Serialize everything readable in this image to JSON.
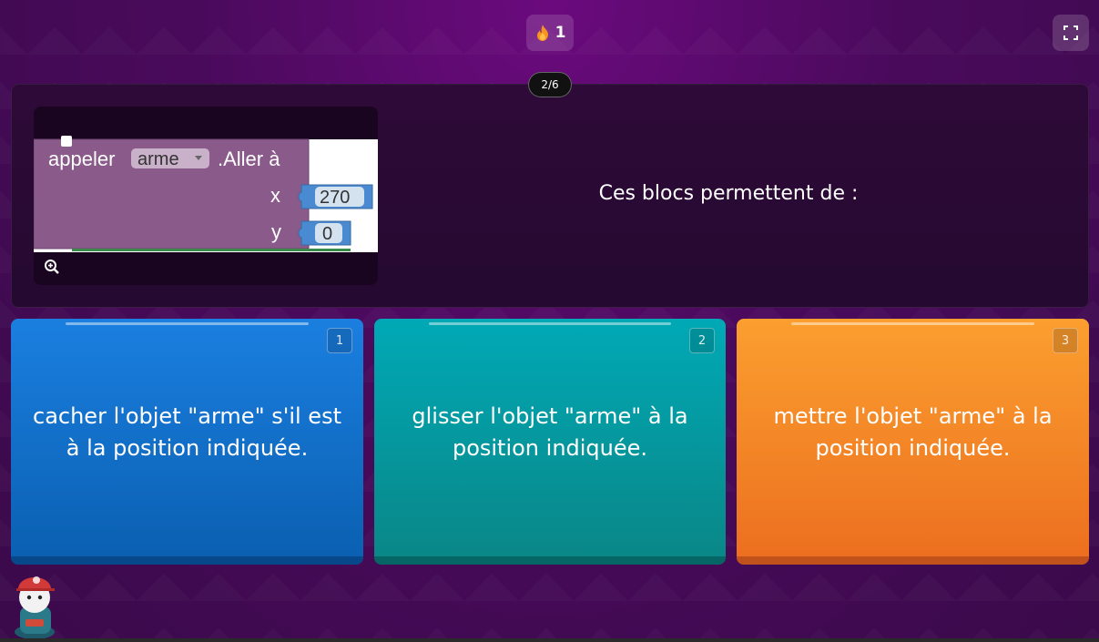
{
  "header": {
    "streak_count": "1",
    "progress": "2/6"
  },
  "question": {
    "text": "Ces blocs permettent de :",
    "image": {
      "call_label": "appeler",
      "object_name": "arme",
      "method_label": ".Aller à",
      "x_label": "x",
      "x_value": "270",
      "y_label": "y",
      "y_value": "0"
    }
  },
  "options": [
    {
      "number": "1",
      "text_line1": "cacher l'objet \"arme\" s'il est",
      "text_line2": "à la position indiquée."
    },
    {
      "number": "2",
      "text_line1": "glisser l'objet \"arme\" à la",
      "text_line2": "position indiquée."
    },
    {
      "number": "3",
      "text_line1": "mettre l'objet \"arme\" à la",
      "text_line2": "position indiquée."
    }
  ],
  "colors": {
    "option1": "#1b7fe0",
    "option2": "#00a9b6",
    "option3": "#fb9f2f",
    "background": "#4a0a5c"
  },
  "icons": [
    "flame-icon",
    "fullscreen-icon",
    "zoom-in-icon",
    "avatar-icon"
  ]
}
